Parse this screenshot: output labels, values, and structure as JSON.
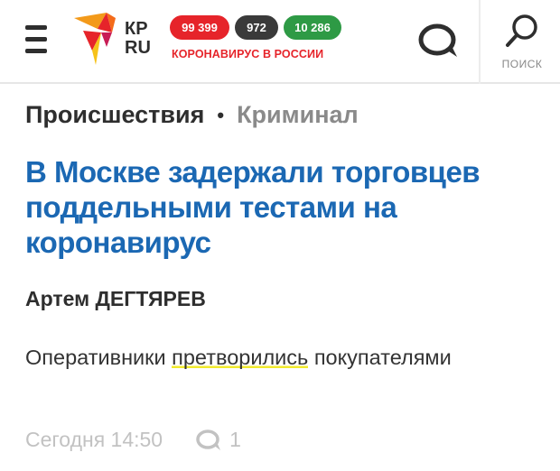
{
  "header": {
    "stats": {
      "cases": "99 399",
      "deaths": "972",
      "recovered": "10 286",
      "caption": "КОРОНАВИРУС В РОССИИ"
    },
    "search_label": "ПОИСК",
    "colors": {
      "red": "#e6242a",
      "dark": "#3a3a3a",
      "green": "#2e9a45"
    }
  },
  "article": {
    "breadcrumb": {
      "section": "Происшествия",
      "separator": "•",
      "subsection": "Криминал"
    },
    "title": "В Москве задержали торговцев поддельными тестами на коронавирус",
    "author": "Артем ДЕГТЯРЕВ",
    "lead_before": "Оперативники ",
    "lead_highlight": "претворились",
    "lead_after": " покупателями",
    "timestamp": "Сегодня 14:50",
    "comments_count": "1",
    "title_color": "#1b68b3",
    "highlight_color": "#f1ea2c"
  },
  "icons": {
    "menu": "hamburger-menu-icon",
    "logo": "kp-ru-logo",
    "chat": "chat-bubble-icon",
    "search": "search-icon",
    "comment": "comment-icon"
  }
}
